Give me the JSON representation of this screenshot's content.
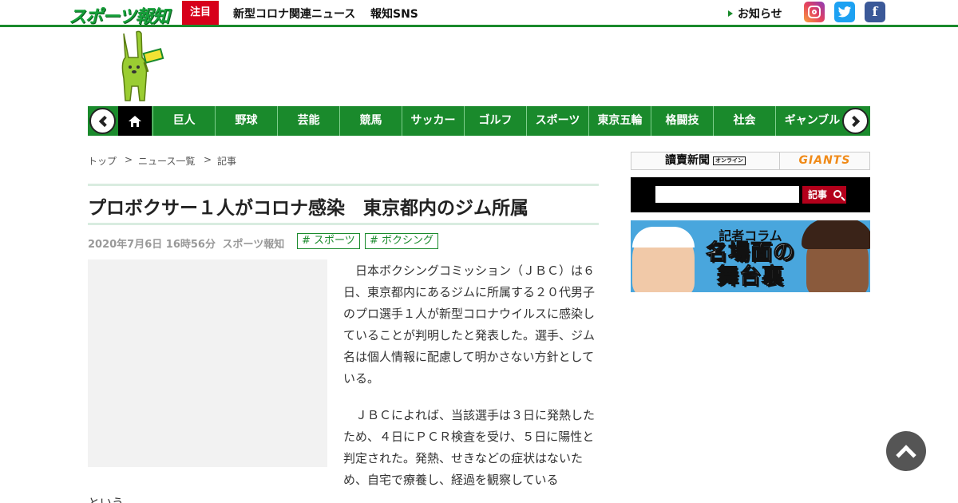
{
  "header": {
    "logo": "スポーツ報知",
    "badge": "注目",
    "links": [
      "新型コロナ関連ニュース",
      "報知SNS"
    ],
    "notice": "お知らせ",
    "social": [
      "instagram-icon",
      "twitter-icon",
      "facebook-icon"
    ]
  },
  "nav": {
    "items": [
      "巨人",
      "野球",
      "芸能",
      "競馬",
      "サッカー",
      "ゴルフ",
      "スポーツ",
      "東京五輪",
      "格闘技",
      "社会",
      "ギャンブル"
    ]
  },
  "breadcrumb": [
    "トップ",
    "ニュース一覧",
    "記事"
  ],
  "breadcrumb_sep": ">",
  "article": {
    "headline": "プロボクサー１人がコロナ感染　東京都内のジム所属",
    "date": "2020年7月6日 16時56分",
    "source": "スポーツ報知",
    "tags": [
      "# スポーツ",
      "# ボクシング"
    ],
    "paragraphs": [
      "日本ボクシングコミッション（ＪＢＣ）は６日、東京都内にあるジムに所属する２０代男子のプロ選手１人が新型コロナウイルスに感染していることが判明したと発表した。選手、ジム名は個人情報に配慮して明かさない方針としている。",
      "ＪＢＣによれば、当該選手は３日に発熱したため、４日にＰＣＲ検査を受け、５日に陽性と判定された。発熱、せきなどの症状はないため、自宅で療養し、経過を観察している"
    ],
    "tail": "という。"
  },
  "sidebar": {
    "yomiuri": "讀賣新聞",
    "yomiuri_badge": "オンライン",
    "giants": "GIANTS",
    "search_button": "記事",
    "search_value": "",
    "ad_title": "記者コラム",
    "ad_big_1": "名場面の",
    "ad_big_2": "舞台裏"
  },
  "colors": {
    "brand_green": "#1a8a2c",
    "badge_red": "#d7001a",
    "search_red": "#b3001b"
  }
}
